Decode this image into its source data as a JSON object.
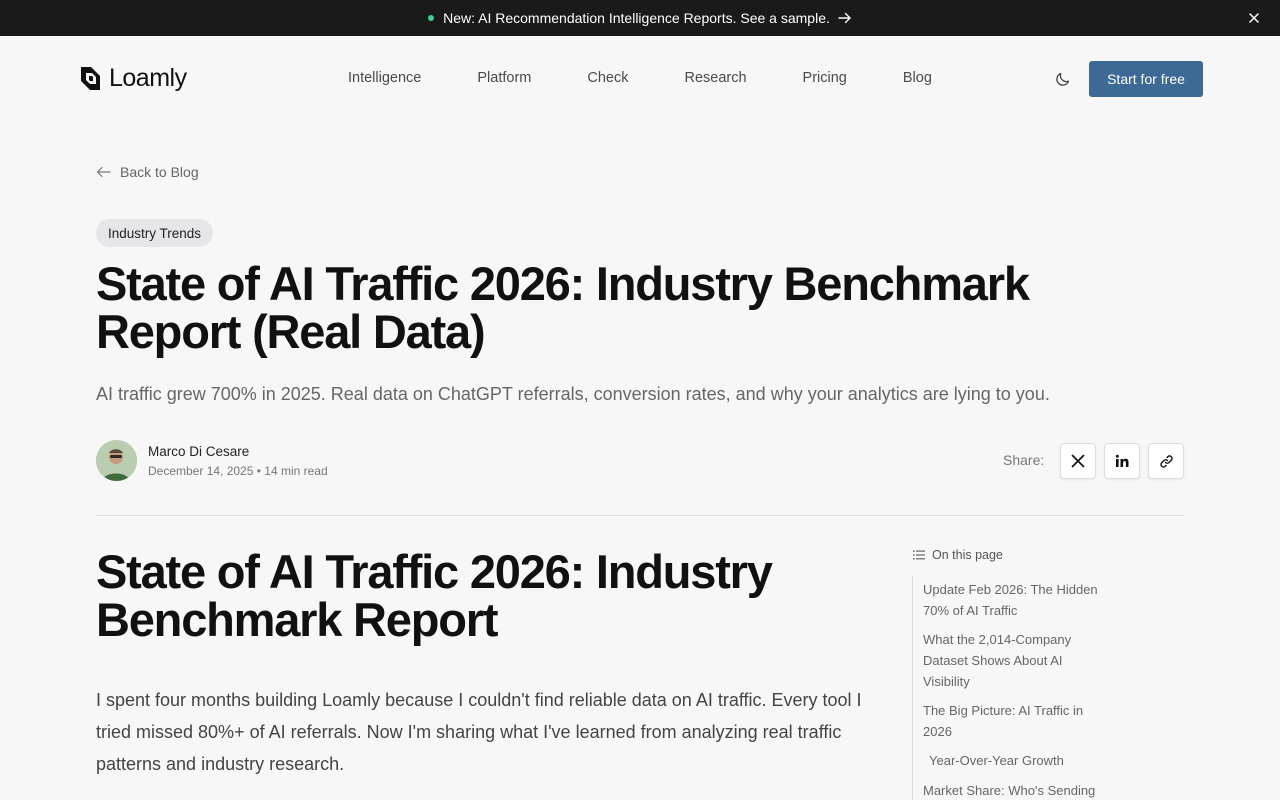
{
  "announcement": {
    "text": "New: AI Recommendation Intelligence Reports. See a sample.",
    "accent_color": "#3ecf8e",
    "arrow_icon": "arrow-right-icon",
    "close_icon": "close-icon"
  },
  "header": {
    "logo_text": "Loamly",
    "nav": [
      "Intelligence",
      "Platform",
      "Check",
      "Research",
      "Pricing",
      "Blog"
    ],
    "theme_icon": "moon-icon",
    "cta_label": "Start for free",
    "cta_color": "#3d6a94"
  },
  "article": {
    "back_label": "Back to Blog",
    "category": "Industry Trends",
    "title": "State of AI Traffic 2026: Industry Benchmark Report (Real Data)",
    "subtitle": "AI traffic grew 700% in 2025. Real data on ChatGPT referrals, conversion rates, and why your analytics are lying to you.",
    "author": {
      "name": "Marco Di Cesare",
      "meta": "December 14, 2025 • 14 min read"
    },
    "share": {
      "label": "Share:",
      "icons": [
        "x-icon",
        "linkedin-icon",
        "link-icon"
      ]
    },
    "heading": "State of AI Traffic 2026: Industry Benchmark Report",
    "intro": "I spent four months building Loamly because I couldn't find reliable data on AI traffic. Every tool I tried missed 80%+ of AI referrals. Now I'm sharing what I've learned from analyzing real traffic patterns and industry research."
  },
  "toc": {
    "title": "On this page",
    "items": [
      "Update Feb 2026: The Hidden 70% of AI Traffic",
      "What the 2,014-Company Dataset Shows About AI Visibility",
      "The Big Picture: AI Traffic in 2026",
      "Year-Over-Year Growth",
      "Market Share: Who's Sending"
    ]
  }
}
